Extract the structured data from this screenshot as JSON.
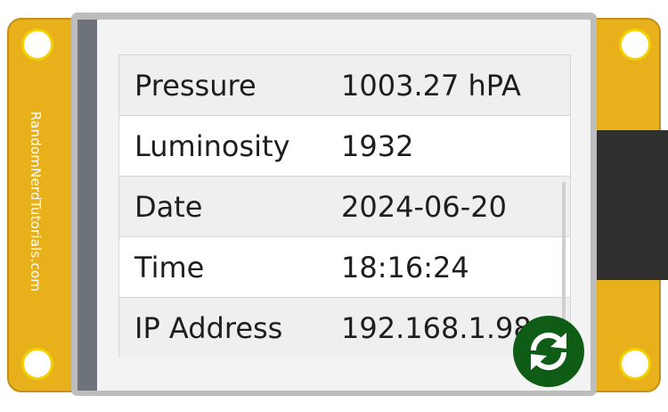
{
  "board": {
    "brand_text": "RandomNerdTutorials.com",
    "color": "#e8b11c"
  },
  "readings": [
    {
      "label": "Pressure",
      "value": "1003.27 hPA"
    },
    {
      "label": "Luminosity",
      "value": "1932"
    },
    {
      "label": "Date",
      "value": "2024-06-20"
    },
    {
      "label": "Time",
      "value": "18:16:24"
    },
    {
      "label": "IP Address",
      "value": "192.168.1.98"
    }
  ],
  "refresh_button": {
    "icon": "refresh-icon",
    "color": "#0f5c17"
  }
}
